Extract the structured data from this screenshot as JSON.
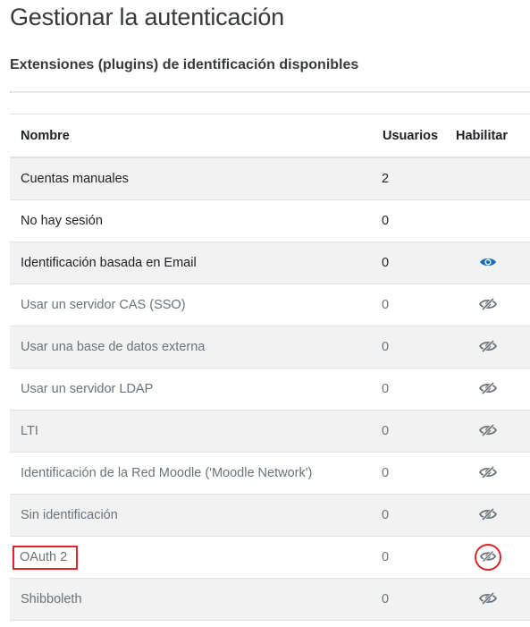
{
  "page": {
    "title": "Gestionar la autenticación",
    "section_title": "Extensiones (plugins) de identificación disponibles"
  },
  "table": {
    "headers": {
      "name": "Nombre",
      "users": "Usuarios",
      "enable": "Habilitar"
    },
    "rows": [
      {
        "name": "Cuentas manuales",
        "users": "2",
        "enable_icon": "none",
        "enabled": true
      },
      {
        "name": "No hay sesión",
        "users": "0",
        "enable_icon": "none",
        "enabled": true
      },
      {
        "name": "Identificación basada en Email",
        "users": "0",
        "enable_icon": "eye-icon",
        "enabled": true
      },
      {
        "name": "Usar un servidor CAS (SSO)",
        "users": "0",
        "enable_icon": "eye-slash-icon",
        "enabled": false
      },
      {
        "name": "Usar una base de datos externa",
        "users": "0",
        "enable_icon": "eye-slash-icon",
        "enabled": false
      },
      {
        "name": "Usar un servidor LDAP",
        "users": "0",
        "enable_icon": "eye-slash-icon",
        "enabled": false
      },
      {
        "name": "LTI",
        "users": "0",
        "enable_icon": "eye-slash-icon",
        "enabled": false
      },
      {
        "name": "Identificación de la Red Moodle ('Moodle Network')",
        "users": "0",
        "enable_icon": "eye-slash-icon",
        "enabled": false
      },
      {
        "name": "Sin identificación",
        "users": "0",
        "enable_icon": "eye-slash-icon",
        "enabled": false
      },
      {
        "name": "OAuth 2",
        "users": "0",
        "enable_icon": "eye-slash-icon",
        "enabled": false,
        "highlighted": true
      },
      {
        "name": "Shibboleth",
        "users": "0",
        "enable_icon": "eye-slash-icon",
        "enabled": false
      }
    ]
  },
  "colors": {
    "eye_enabled": "#0f6cbf",
    "eye_disabled": "#6a737b",
    "highlight": "#d9262b"
  }
}
